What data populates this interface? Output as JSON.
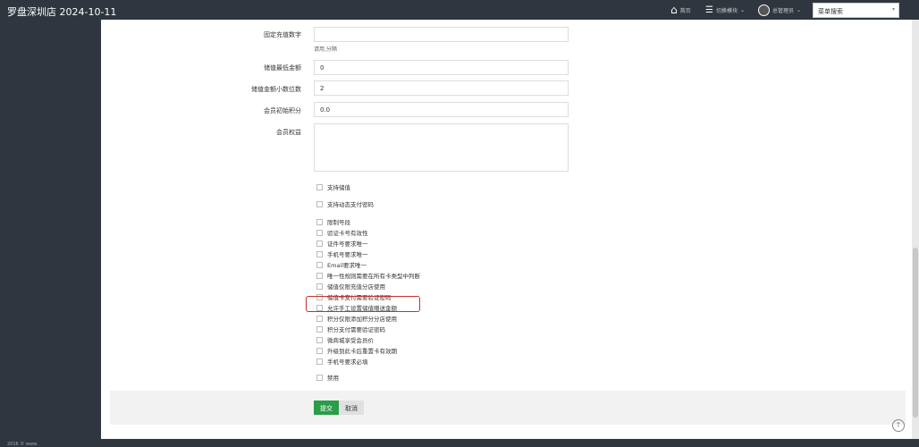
{
  "header": {
    "title": "罗盘深圳店 2024-10-11",
    "home": "首页",
    "modules": "切换模块",
    "user": "总管理员",
    "menu_search": "菜单搜索"
  },
  "form": {
    "fixed_recharge": {
      "label": "固定充值数字",
      "value": "",
      "help": "请用,分隔"
    },
    "min_amount": {
      "label": "储值最低金额",
      "value": "0"
    },
    "decimals": {
      "label": "储值金额小数位数",
      "value": "2"
    },
    "init_points": {
      "label": "会员初始积分",
      "value": "0.0"
    },
    "benefits": {
      "label": "会员权益",
      "value": ""
    },
    "checkbox_groups": [
      [
        "支持储值"
      ],
      [
        "支持动态支付密码"
      ],
      [
        "限制号段",
        "验证卡号有效性",
        "证件号要求唯一",
        "手机号要求唯一",
        "Email要求唯一",
        "唯一性规则需要在所有卡类型中判断",
        "储值仅限充值分店使用",
        "储值卡支付需要验证密码",
        "允许手工设置储值赠送金额",
        "积分仅限添加积分分店使用",
        "积分支付需要验证密码",
        "微商城享受会员价",
        "升级到此卡后重置卡有效期",
        "手机号要求必填"
      ],
      [
        "禁用"
      ]
    ],
    "highlighted": "允许手工设置储值赠送金额",
    "submit": "提交",
    "cancel": "取消"
  },
  "footer": "2016 © www."
}
